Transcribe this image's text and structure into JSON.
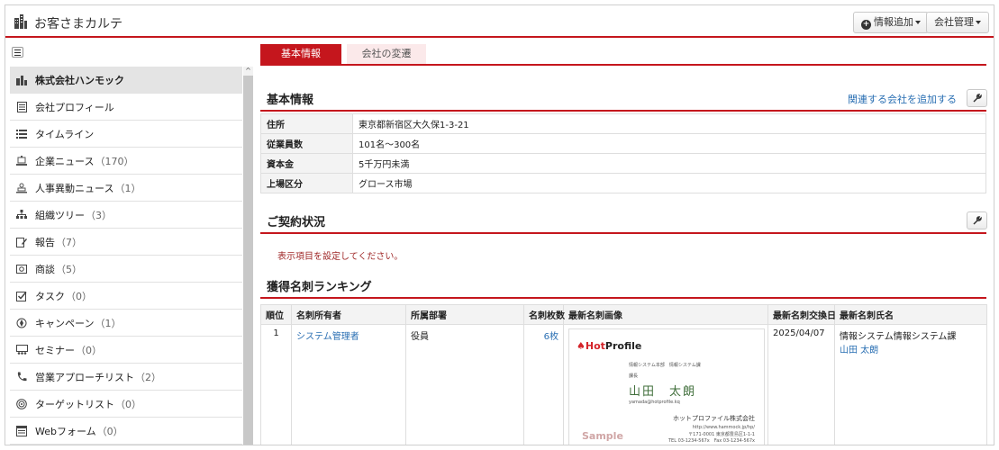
{
  "app": {
    "title": "お客さまカルテ"
  },
  "header": {
    "add_info_label": "情報追加",
    "company_admin_label": "会社管理"
  },
  "sidebar": {
    "items": [
      {
        "label": "株式会社ハンモック",
        "count": "",
        "icon": "building-icon"
      },
      {
        "label": "会社プロフィール",
        "count": "",
        "icon": "document-icon"
      },
      {
        "label": "タイムライン",
        "count": "",
        "icon": "list-icon"
      },
      {
        "label": "企業ニュース",
        "count": "（170）",
        "icon": "news-icon"
      },
      {
        "label": "人事異動ニュース",
        "count": "（1）",
        "icon": "personnel-news-icon"
      },
      {
        "label": "組織ツリー",
        "count": "（3）",
        "icon": "org-tree-icon"
      },
      {
        "label": "報告",
        "count": "（7）",
        "icon": "report-icon"
      },
      {
        "label": "商談",
        "count": "（5）",
        "icon": "deal-icon"
      },
      {
        "label": "タスク",
        "count": "（0）",
        "icon": "task-check-icon"
      },
      {
        "label": "キャンペーン",
        "count": "（1）",
        "icon": "campaign-icon"
      },
      {
        "label": "セミナー",
        "count": "（0）",
        "icon": "seminar-icon"
      },
      {
        "label": "営業アプローチリスト",
        "count": "（2）",
        "icon": "phone-icon"
      },
      {
        "label": "ターゲットリスト",
        "count": "（0）",
        "icon": "target-icon"
      },
      {
        "label": "Webフォーム",
        "count": "（0）",
        "icon": "webform-icon"
      }
    ]
  },
  "tabs": [
    {
      "label": "基本情報",
      "active": true
    },
    {
      "label": "会社の変遷",
      "active": false
    }
  ],
  "basic_info": {
    "title": "基本情報",
    "add_related_link": "関連する会社を追加する",
    "rows": [
      {
        "key": "住所",
        "value": "東京都新宿区大久保1-3-21"
      },
      {
        "key": "従業員数",
        "value": "101名～300名"
      },
      {
        "key": "資本金",
        "value": "5千万円未満"
      },
      {
        "key": "上場区分",
        "value": "グロース市場"
      }
    ]
  },
  "contract": {
    "title": "ご契約状況",
    "notice": "表示項目を設定してください。"
  },
  "ranking": {
    "title": "獲得名刺ランキング",
    "headers": [
      "順位",
      "名刺所有者",
      "所属部署",
      "名刺枚数",
      "最新名刺画像",
      "最新名刺交換日",
      "最新名刺氏名"
    ],
    "rows": [
      {
        "rank": "1",
        "owner": "システム管理者",
        "department": "役員",
        "count": "6枚",
        "date": "2025/04/07",
        "latest_dept": "情報システム情報システム課",
        "latest_name": "山田 太朗"
      }
    ]
  },
  "card": {
    "logo_hot": "Hot",
    "logo_profile": "Profile",
    "dept_line": "情報システム本部　情報システム課",
    "title_line": "課長",
    "name": "山田　太朗",
    "email": "yamada@hotprofile.kq",
    "company": "ホットプロファイル株式会社",
    "url": "http://www.hammock.jp/hp/",
    "address": "〒171-0001 東京都豊島区1-1-1",
    "tel": "TEL 03-1234-567x　Fax 03-1234-567x",
    "sample": "Sample"
  }
}
